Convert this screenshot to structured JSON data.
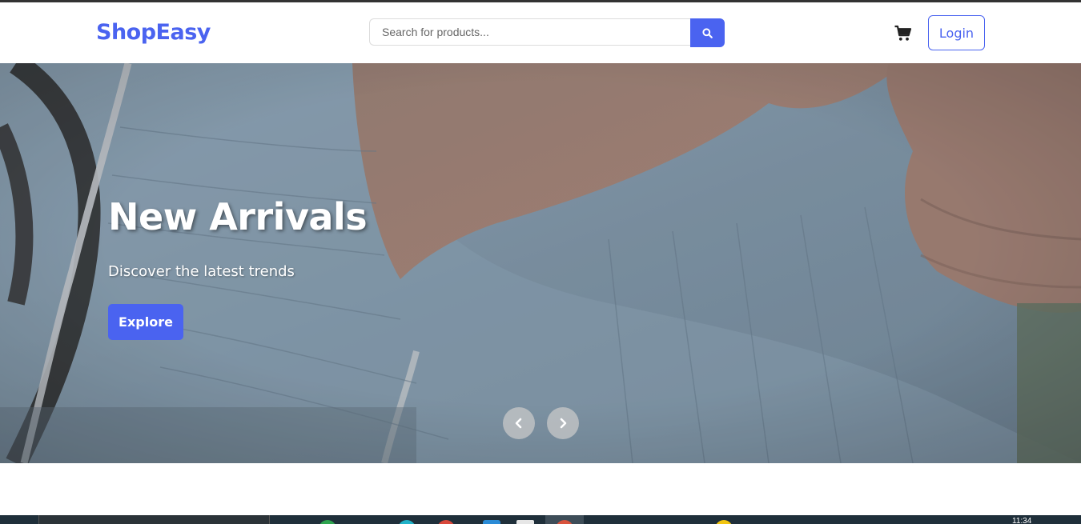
{
  "header": {
    "logo": "ShopEasy",
    "search_placeholder": "Search for products...",
    "search_value": "",
    "search_icon": "search-icon",
    "cart_icon": "cart-icon",
    "login_label": "Login"
  },
  "hero": {
    "title": "New Arrivals",
    "subtitle": "Discover the latest trends",
    "cta_label": "Explore",
    "prev_icon": "chevron-left-icon",
    "next_icon": "chevron-right-icon"
  },
  "taskbar": {
    "time": "11:34"
  },
  "colors": {
    "brand": "#4a63f0",
    "header_bg": "#ffffff",
    "taskbar_bg": "#1f2f3a"
  }
}
